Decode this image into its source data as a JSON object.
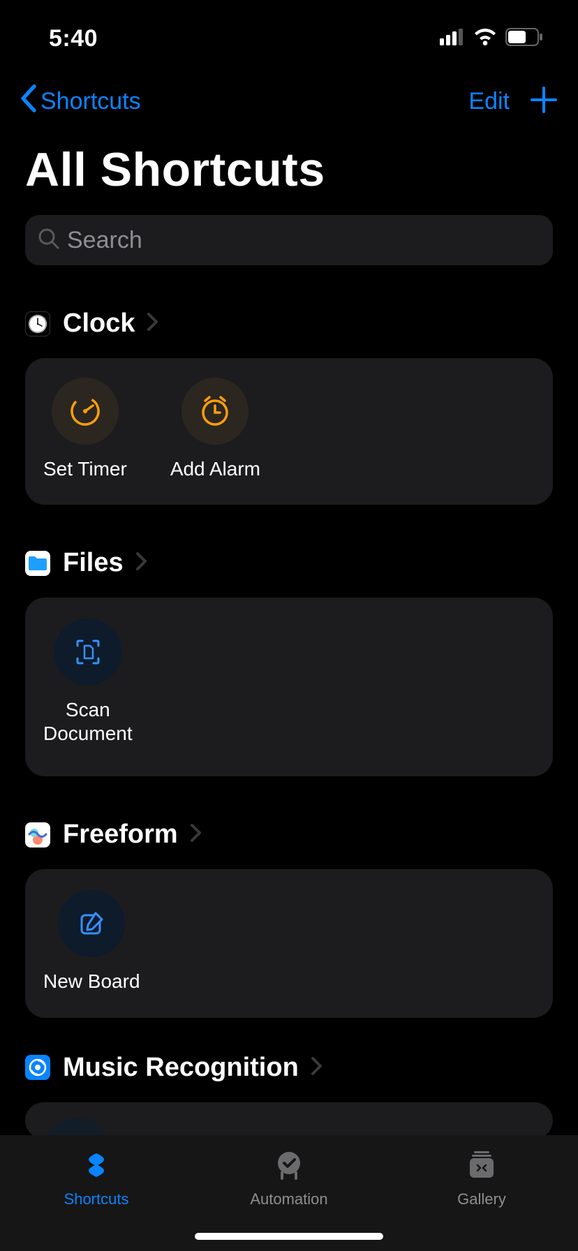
{
  "status": {
    "time": "5:40"
  },
  "nav": {
    "back_label": "Shortcuts",
    "edit_label": "Edit"
  },
  "page": {
    "title": "All Shortcuts"
  },
  "search": {
    "placeholder": "Search"
  },
  "sections": [
    {
      "app": "Clock",
      "shortcuts": [
        {
          "label": "Set Timer",
          "icon": "timer",
          "color": "orange"
        },
        {
          "label": "Add Alarm",
          "icon": "alarm",
          "color": "orange"
        }
      ]
    },
    {
      "app": "Files",
      "shortcuts": [
        {
          "label": "Scan\nDocument",
          "icon": "scan-doc",
          "color": "blue"
        }
      ]
    },
    {
      "app": "Freeform",
      "shortcuts": [
        {
          "label": "New Board",
          "icon": "compose",
          "color": "blue"
        }
      ]
    },
    {
      "app": "Music Recognition",
      "shortcuts": []
    }
  ],
  "tabs": {
    "shortcuts": "Shortcuts",
    "automation": "Automation",
    "gallery": "Gallery"
  }
}
